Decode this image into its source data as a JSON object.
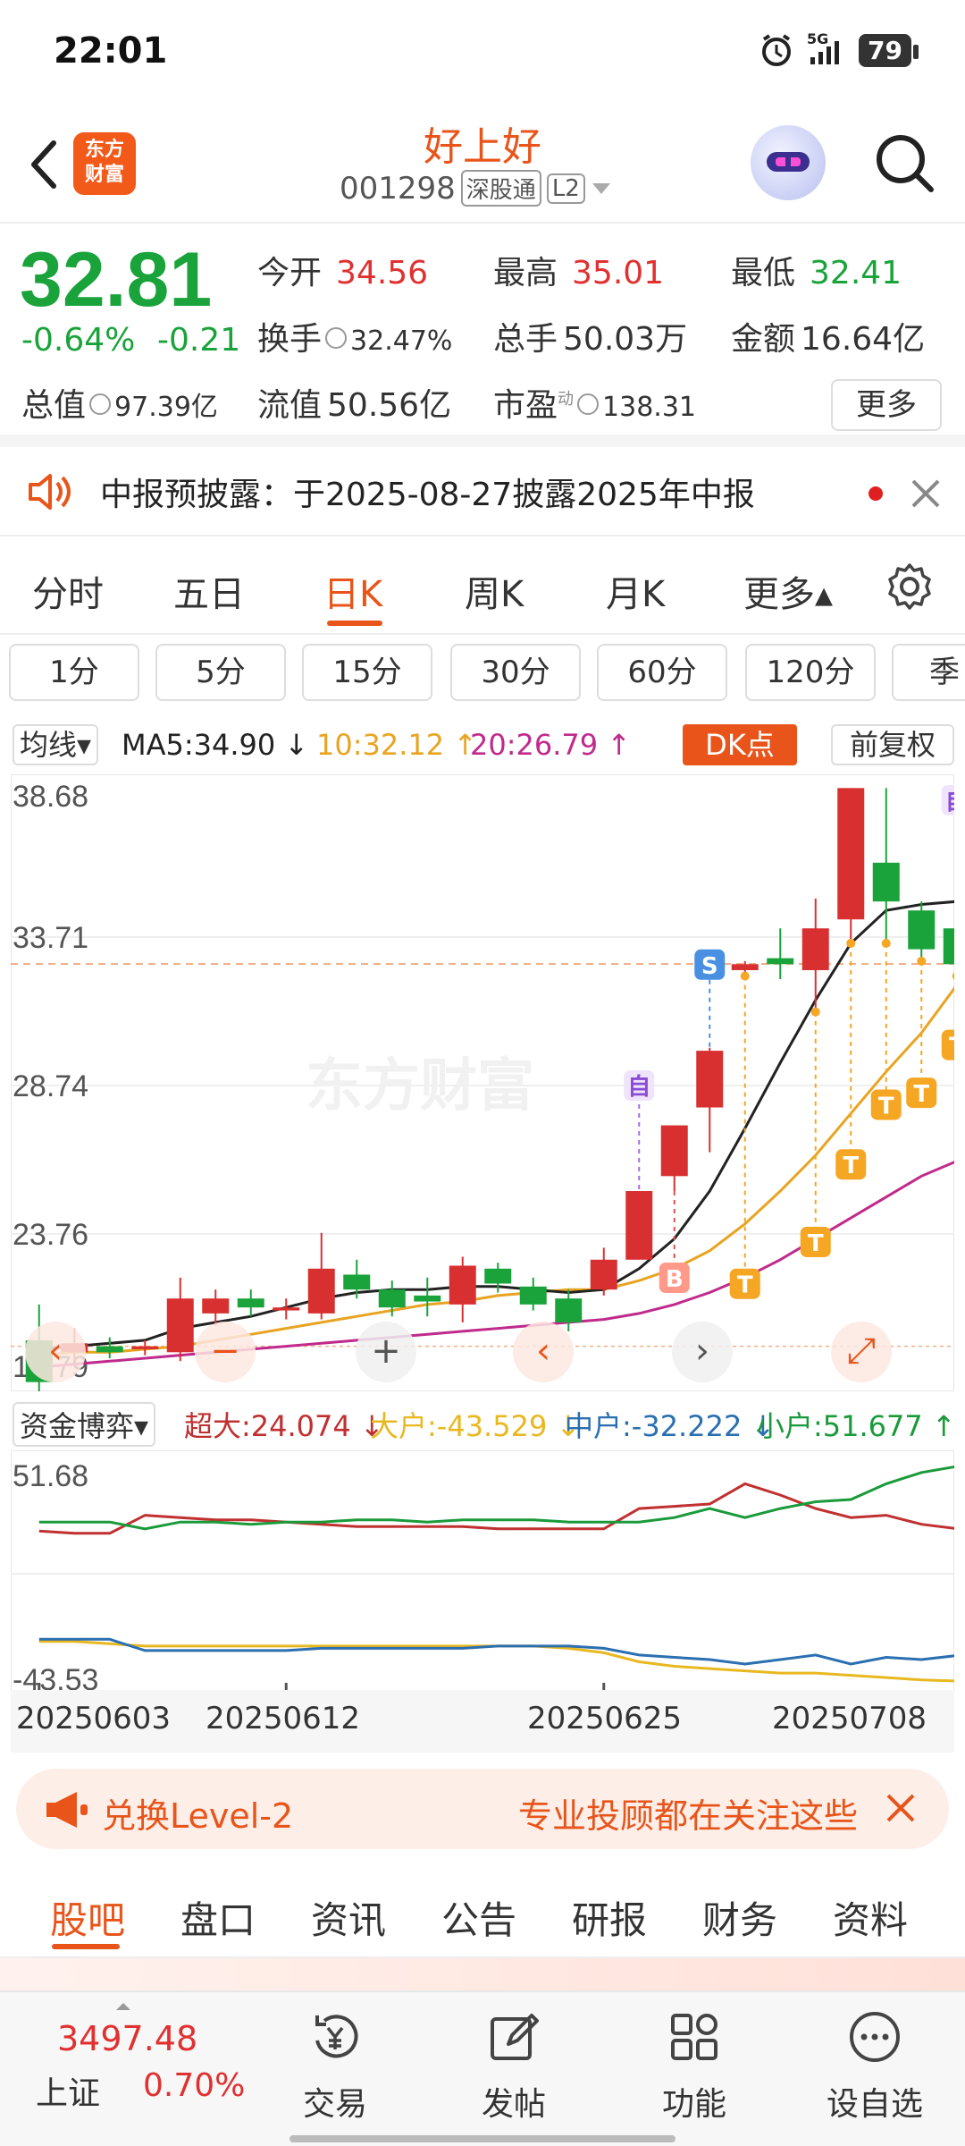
{
  "status": {
    "time": "22:01",
    "signal": "5G",
    "battery": "79"
  },
  "header": {
    "logo_line1": "东方",
    "logo_line2": "财富",
    "stock_name": "好上好",
    "stock_code": "001298",
    "tag_connect": "深股通",
    "tag_level": "L2"
  },
  "quote": {
    "price": "32.81",
    "change_pct": "-0.64%",
    "change": "-0.21",
    "open_label": "今开",
    "open": "34.56",
    "high_label": "最高",
    "high": "35.01",
    "low_label": "最低",
    "low": "32.41",
    "turnover_label": "换手",
    "turnover": "32.47%",
    "volume_label": "总手",
    "volume": "50.03万",
    "amount_label": "金额",
    "amount": "16.64亿",
    "mktcap_label": "总值",
    "mktcap": "97.39亿",
    "float_label": "流值",
    "float": "50.56亿",
    "pe_label": "市盈",
    "pe_sup": "动",
    "pe": "138.31",
    "more": "更多"
  },
  "notice": {
    "text": "中报预披露：于2025-08-27披露2025年中报"
  },
  "period_tabs": [
    "分时",
    "五日",
    "日K",
    "周K",
    "月K",
    "更多▴"
  ],
  "interval_tabs": [
    "1分",
    "5分",
    "15分",
    "30分",
    "60分",
    "120分",
    "季"
  ],
  "ma_row": {
    "selector": "均线▾",
    "ma5": "MA5:34.90 ↓",
    "ma10": "10:32.12 ↑",
    "ma20": "20:26.79 ↑",
    "dk": "DK点",
    "adjust": "前复权",
    "colors": {
      "ma5": "#222222",
      "ma10": "#e8a421",
      "ma20": "#c02a8c"
    }
  },
  "chart_data": [
    {
      "type": "candlestick",
      "ylim": [
        18.79,
        38.68
      ],
      "y_ticks": [
        "38.68",
        "33.71",
        "28.74",
        "23.76",
        "18.79"
      ],
      "watermark": "东方财富",
      "ref_price": 32.81,
      "candles": [
        {
          "o": 20.2,
          "c": 18.8,
          "h": 21.4,
          "l": 18.4
        },
        {
          "o": 19.8,
          "c": 20.1,
          "h": 20.6,
          "l": 19.5
        },
        {
          "o": 20.0,
          "c": 19.8,
          "h": 20.3,
          "l": 19.6
        },
        {
          "o": 19.9,
          "c": 20.0,
          "h": 20.2,
          "l": 19.7
        },
        {
          "o": 19.8,
          "c": 21.6,
          "h": 22.3,
          "l": 19.5
        },
        {
          "o": 21.1,
          "c": 21.6,
          "h": 21.9,
          "l": 20.7
        },
        {
          "o": 21.6,
          "c": 21.3,
          "h": 21.9,
          "l": 21.0
        },
        {
          "o": 21.2,
          "c": 21.3,
          "h": 21.6,
          "l": 20.9
        },
        {
          "o": 21.1,
          "c": 22.6,
          "h": 23.8,
          "l": 20.9
        },
        {
          "o": 22.4,
          "c": 21.9,
          "h": 22.9,
          "l": 21.6
        },
        {
          "o": 21.9,
          "c": 21.3,
          "h": 22.2,
          "l": 21.0
        },
        {
          "o": 21.7,
          "c": 21.5,
          "h": 22.3,
          "l": 21.0
        },
        {
          "o": 21.4,
          "c": 22.7,
          "h": 23.0,
          "l": 20.8
        },
        {
          "o": 22.6,
          "c": 22.1,
          "h": 22.8,
          "l": 21.8
        },
        {
          "o": 22.0,
          "c": 21.4,
          "h": 22.3,
          "l": 21.2
        },
        {
          "o": 21.6,
          "c": 20.8,
          "h": 21.9,
          "l": 20.5
        },
        {
          "o": 21.9,
          "c": 22.9,
          "h": 23.3,
          "l": 21.7
        },
        {
          "o": 22.9,
          "c": 25.2,
          "h": 25.2,
          "l": 22.9
        },
        {
          "o": 25.7,
          "c": 27.4,
          "h": 27.4,
          "l": 25.2
        },
        {
          "o": 28.0,
          "c": 29.9,
          "h": 30.0,
          "l": 26.5
        },
        {
          "o": 32.6,
          "c": 32.8,
          "h": 32.9,
          "l": 32.4
        },
        {
          "o": 33.0,
          "c": 32.8,
          "h": 34.0,
          "l": 32.3
        },
        {
          "o": 32.6,
          "c": 34.0,
          "h": 35.0,
          "l": 31.2
        },
        {
          "o": 34.3,
          "c": 38.7,
          "h": 38.7,
          "l": 33.5
        },
        {
          "o": 36.2,
          "c": 34.9,
          "h": 38.7,
          "l": 33.5
        },
        {
          "o": 34.6,
          "c": 33.3,
          "h": 34.9,
          "l": 32.9
        },
        {
          "o": 34.0,
          "c": 32.8,
          "h": 35.0,
          "l": 32.4
        }
      ],
      "ma5": [
        19.9,
        20.0,
        20.1,
        20.2,
        20.6,
        20.8,
        21.0,
        21.3,
        21.6,
        21.8,
        21.9,
        21.9,
        22.0,
        22.0,
        21.9,
        21.8,
        21.9,
        22.6,
        23.6,
        25.2,
        27.3,
        29.5,
        31.6,
        33.5,
        34.6,
        34.8,
        34.9
      ],
      "ma10": [
        19.7,
        19.8,
        19.8,
        19.9,
        20.0,
        20.2,
        20.4,
        20.6,
        20.8,
        21.0,
        21.2,
        21.4,
        21.5,
        21.7,
        21.8,
        21.9,
        21.9,
        22.2,
        22.6,
        23.2,
        24.1,
        25.2,
        26.4,
        27.8,
        29.2,
        30.5,
        32.1
      ],
      "ma20": [
        19.3,
        19.4,
        19.5,
        19.6,
        19.7,
        19.8,
        19.9,
        20.0,
        20.1,
        20.2,
        20.3,
        20.4,
        20.5,
        20.6,
        20.7,
        20.8,
        20.9,
        21.1,
        21.4,
        21.8,
        22.3,
        22.9,
        23.6,
        24.3,
        25.0,
        25.7,
        26.2
      ],
      "markers": [
        {
          "i": 17,
          "label": "自"
        },
        {
          "i": 18,
          "label": "B"
        },
        {
          "i": 19,
          "label": "S"
        },
        {
          "i": 20,
          "label": "T"
        },
        {
          "i": 22,
          "label": "T"
        },
        {
          "i": 23,
          "label": "T"
        },
        {
          "i": 24,
          "label": "T"
        },
        {
          "i": 25,
          "label": "T"
        },
        {
          "i": 26,
          "label": "T"
        },
        {
          "i": 26,
          "label": "自"
        }
      ]
    },
    {
      "type": "line",
      "title": "资金博弈",
      "ylim": [
        -43.53,
        51.68
      ],
      "y_ticks": [
        "51.68",
        "-43.53"
      ],
      "x_tick_labels": [
        "20250603",
        "20250612",
        "20250625",
        "20250708"
      ],
      "series": [
        {
          "name": "超大",
          "latest": "24.074",
          "color": "#c03030",
          "values": [
            23,
            22,
            22,
            30,
            29,
            28,
            28,
            27,
            26,
            25,
            25,
            25,
            25,
            24,
            24,
            24,
            24,
            33,
            34,
            35,
            44,
            39,
            33,
            29,
            30,
            26,
            24.07
          ]
        },
        {
          "name": "大户",
          "latest": "-43.529",
          "color": "#e8b820",
          "values": [
            -26,
            -26,
            -27,
            -28,
            -28,
            -28,
            -28,
            -28,
            -28,
            -28,
            -28,
            -28,
            -28,
            -28,
            -28,
            -29,
            -31,
            -35,
            -37,
            -38,
            -39,
            -40,
            -40,
            -41,
            -42,
            -43,
            -43.53
          ]
        },
        {
          "name": "中户",
          "latest": "-32.222",
          "color": "#2a6fb0",
          "values": [
            -25,
            -25,
            -25,
            -30,
            -30,
            -30,
            -30,
            -30,
            -29,
            -29,
            -29,
            -29,
            -29,
            -28,
            -28,
            -28,
            -29,
            -32,
            -33,
            -34,
            -36,
            -34,
            -32,
            -36,
            -33,
            -34,
            -32.22
          ]
        },
        {
          "name": "小户",
          "latest": "51.677",
          "color": "#1a9a3a",
          "values": [
            27,
            27,
            27,
            24,
            27,
            27,
            26,
            27,
            27,
            28,
            28,
            27,
            28,
            28,
            28,
            27,
            27,
            27,
            29,
            33,
            29,
            33,
            36,
            37,
            44,
            49,
            51.68
          ]
        }
      ]
    }
  ],
  "chart_controls": {
    "pan_left": "‹",
    "pan_right": "›",
    "zoom_in": "+",
    "zoom_out": "−",
    "expand": "⤢"
  },
  "fund_row": {
    "selector": "资金博弈▾",
    "super": "超大:24.074 ↓",
    "large": "大户:-43.529 ↓",
    "medium": "中户:-32.222 ↓",
    "small": "小户:51.677 ↑"
  },
  "ad": {
    "left": "兑换Level-2",
    "right": "专业投顾都在关注这些"
  },
  "bottom_tabs": [
    "股吧",
    "盘口",
    "资讯",
    "公告",
    "研报",
    "财务",
    "资料"
  ],
  "toolbar": {
    "index_value": "3497.48",
    "index_name": "上证",
    "index_pct": "0.70%",
    "items": [
      "交易",
      "发帖",
      "功能",
      "设自选"
    ]
  },
  "colors": {
    "accent": "#e8541a",
    "up": "#e03030",
    "down": "#1aa33a"
  }
}
